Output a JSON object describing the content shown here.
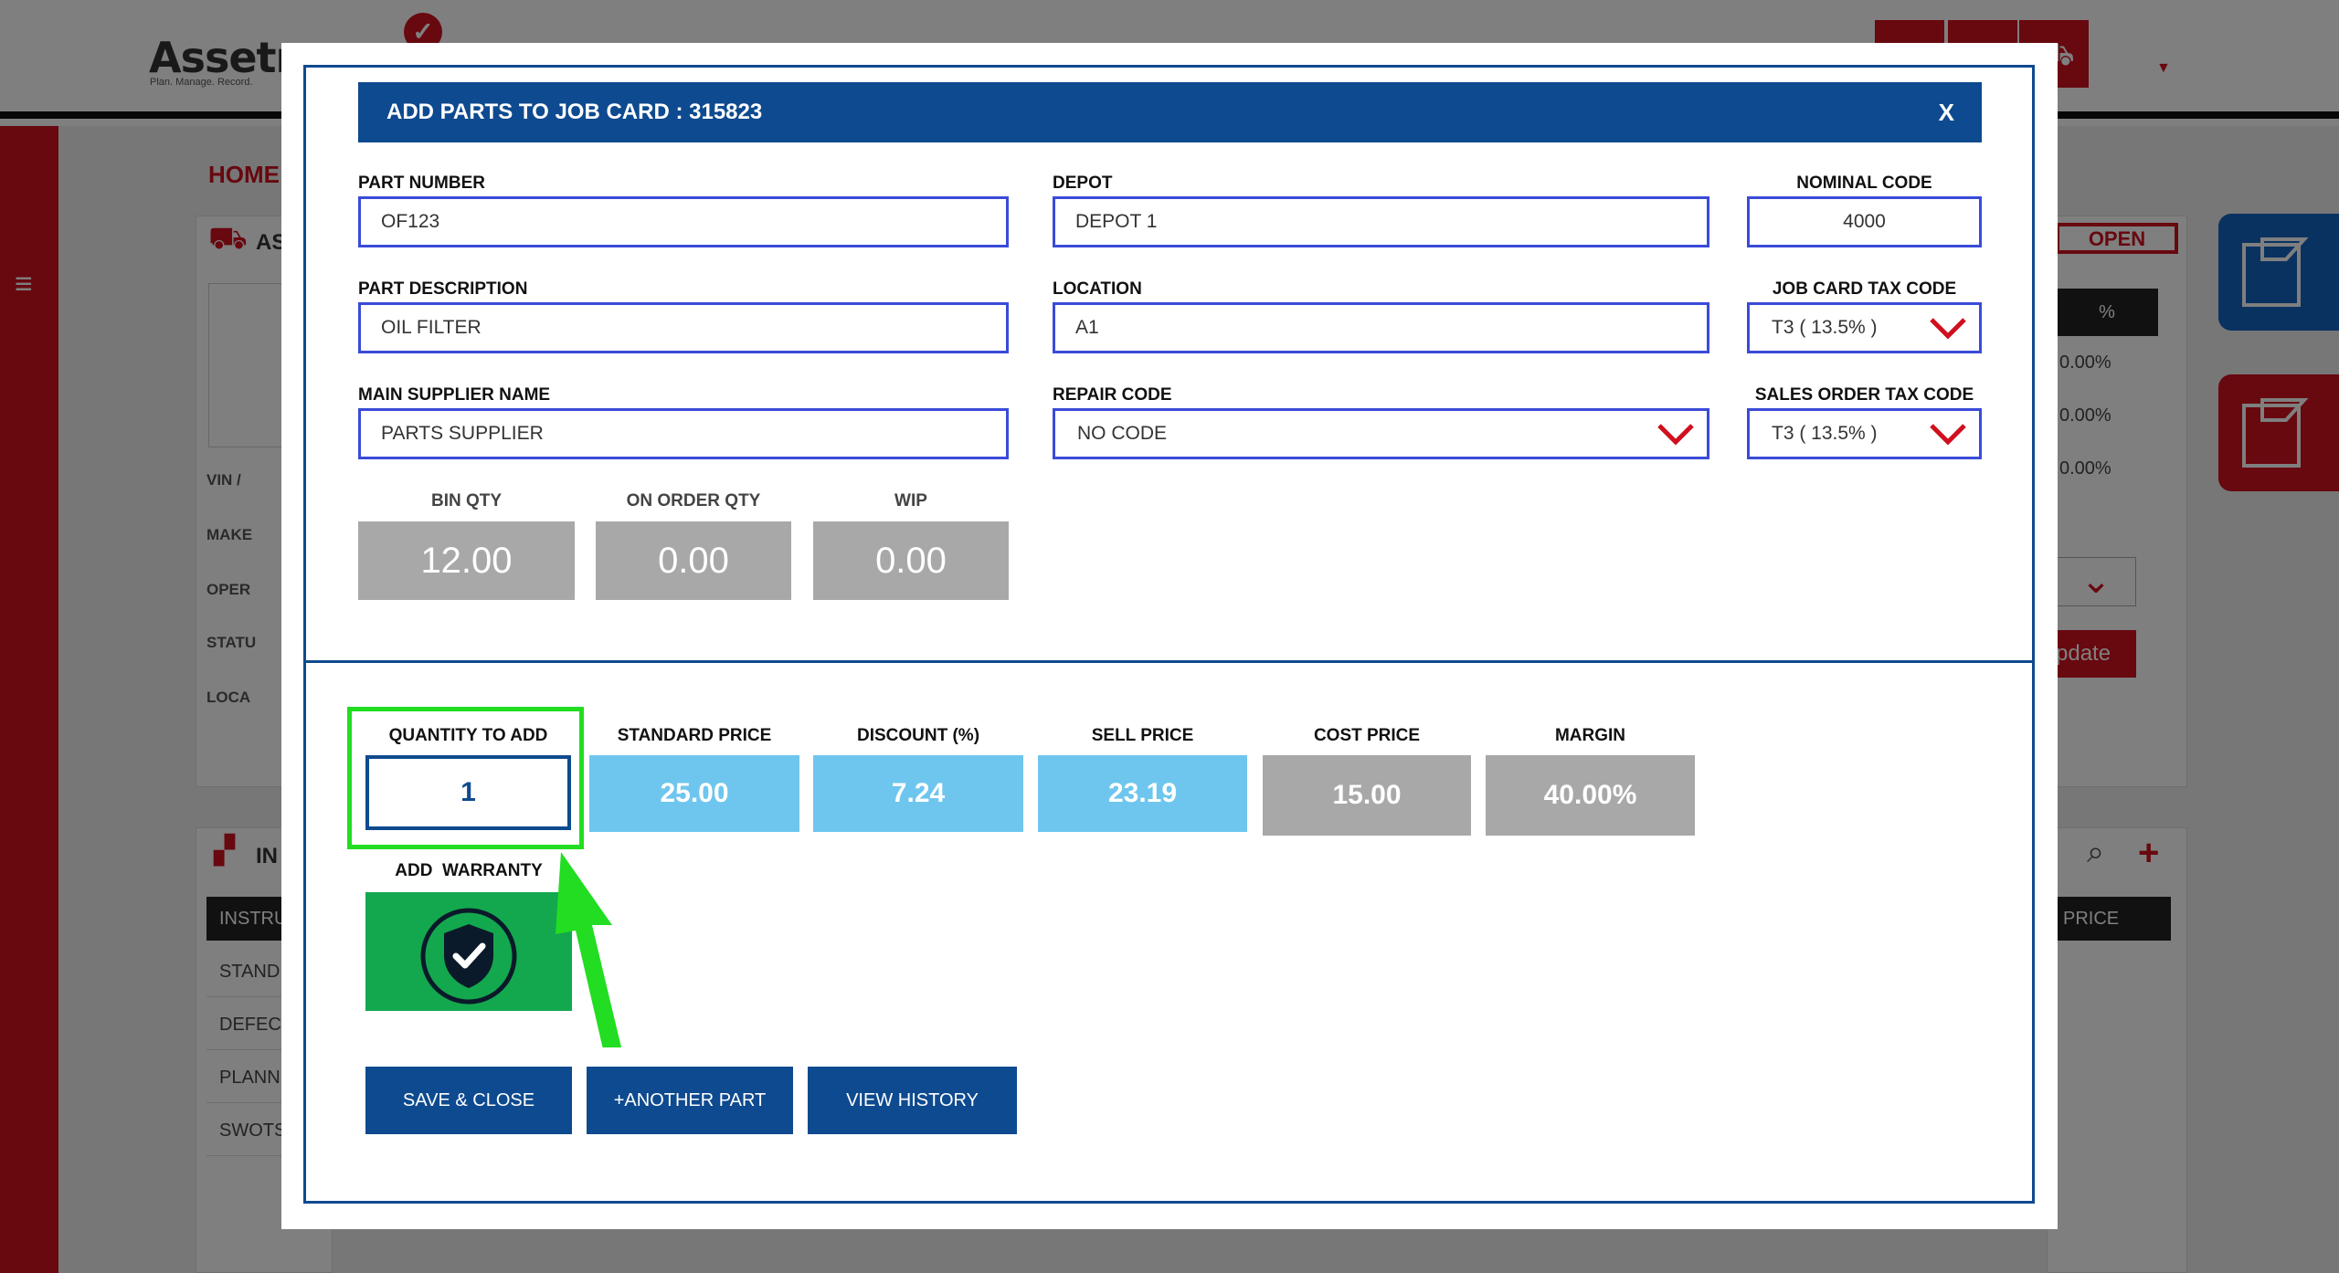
{
  "background": {
    "logo_text": "Assetm",
    "logo_tagline": "Plan. Manage. Record.",
    "breadcrumb_home": "HOME",
    "asset_card_title": "AS",
    "asset_fields": [
      "VIN /",
      "MAKE",
      "OPER",
      "STATU",
      "LOCA"
    ],
    "instructions_title": "IN",
    "instructions_header": "INSTRU",
    "instructions_items": [
      "STAND",
      "DEFEC",
      "PLANN",
      "SWOTS"
    ],
    "status_badge": "OPEN",
    "percent_header": "%",
    "percent_values": [
      "0.00%",
      "0.00%",
      "0.00%"
    ],
    "update_button": "pdate",
    "price_header": "PRICE"
  },
  "modal": {
    "title": "ADD PARTS TO JOB CARD : 315823",
    "close_label": "X",
    "part_number": {
      "label": "PART NUMBER",
      "value": "OF123"
    },
    "depot": {
      "label": "DEPOT",
      "value": "DEPOT 1"
    },
    "nominal_code": {
      "label": "NOMINAL CODE",
      "value": "4000"
    },
    "part_description": {
      "label": "PART DESCRIPTION",
      "value": "OIL FILTER"
    },
    "location": {
      "label": "LOCATION",
      "value": "A1"
    },
    "job_card_tax_code": {
      "label": "JOB CARD TAX CODE",
      "value": "T3 ( 13.5% )"
    },
    "main_supplier_name": {
      "label": "MAIN SUPPLIER NAME",
      "value": "PARTS SUPPLIER"
    },
    "repair_code": {
      "label": "REPAIR CODE",
      "value": "NO CODE"
    },
    "sales_order_tax_code": {
      "label": "SALES ORDER TAX CODE",
      "value": "T3 ( 13.5% )"
    },
    "bin_qty": {
      "label": "BIN QTY",
      "value": "12.00"
    },
    "on_order_qty": {
      "label": "ON ORDER QTY",
      "value": "0.00"
    },
    "wip": {
      "label": "WIP",
      "value": "0.00"
    },
    "quantity_to_add": {
      "label": "QUANTITY TO ADD",
      "value": "1"
    },
    "standard_price": {
      "label": "STANDARD PRICE",
      "value": "25.00"
    },
    "discount": {
      "label": "DISCOUNT (%)",
      "value": "7.24"
    },
    "sell_price": {
      "label": "SELL PRICE",
      "value": "23.19"
    },
    "cost_price": {
      "label": "COST PRICE",
      "value": "15.00"
    },
    "margin": {
      "label": "MARGIN",
      "value": "40.00%"
    },
    "add_warranty_label": "ADD  WARRANTY",
    "buttons": {
      "save_close": "SAVE & CLOSE",
      "another_part": "+ANOTHER PART",
      "view_history": "VIEW HISTORY"
    }
  },
  "colors": {
    "brand_blue": "#0e4a8f",
    "field_border": "#3a4bd8",
    "price_blue": "#6ec6ee",
    "readonly_grey": "#a8a8a8",
    "warranty_green": "#13a84e",
    "highlight_green": "#22dd22",
    "brand_red": "#d0101e"
  },
  "icons": [
    "chevron-down-icon",
    "shield-check-icon",
    "menu-icon",
    "close-icon",
    "arrow-annotation-icon"
  ]
}
